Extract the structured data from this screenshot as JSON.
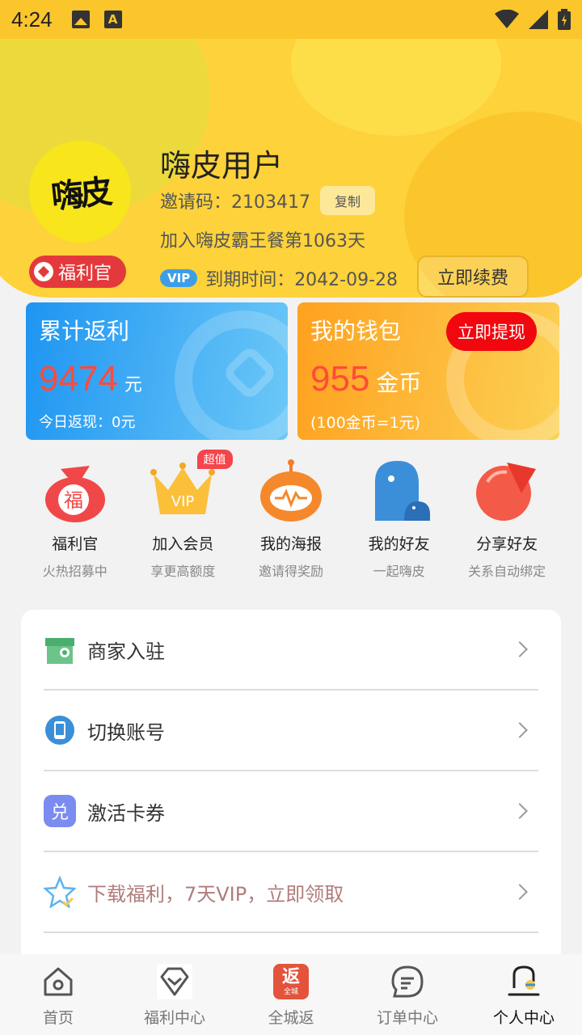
{
  "status_bar": {
    "time": "4:24",
    "icons": [
      "image-icon",
      "text-icon",
      "wifi-icon",
      "signal-icon",
      "battery-icon"
    ]
  },
  "profile": {
    "avatar_text": "嗨皮",
    "welfare_badge": "福利官",
    "username": "嗨皮用户",
    "invite_label": "邀请码：2103417",
    "copy_label": "复制",
    "join_text": "加入嗨皮霸王餐第1063天",
    "vip_label": "VIP",
    "expire_text": "到期时间：2042-09-28",
    "renew_label": "立即续费"
  },
  "rebate_card": {
    "title": "累计返利",
    "amount": "9474",
    "unit": "元",
    "today": "今日返现：0元"
  },
  "wallet_card": {
    "title": "我的钱包",
    "withdraw_label": "立即提现",
    "amount": "955",
    "unit": "金币",
    "rate": "(100金币=1元)"
  },
  "shortcuts": [
    {
      "label": "福利官",
      "sub": "火热招募中",
      "icon": "fortune-bag-icon"
    },
    {
      "label": "加入会员",
      "sub": "享更高额度",
      "icon": "vip-crown-icon",
      "tag": "超值"
    },
    {
      "label": "我的海报",
      "sub": "邀请得奖励",
      "icon": "poster-robot-icon"
    },
    {
      "label": "我的好友",
      "sub": "一起嗨皮",
      "icon": "friends-bird-icon"
    },
    {
      "label": "分享好友",
      "sub": "关系自动绑定",
      "icon": "share-peach-icon"
    }
  ],
  "menu": [
    {
      "label": "商家入驻",
      "icon": "store-icon"
    },
    {
      "label": "切换账号",
      "icon": "phone-icon"
    },
    {
      "label": "激活卡券",
      "icon": "redeem-icon",
      "icon_text": "兑"
    },
    {
      "label": "下载福利，7天VIP，立即领取",
      "icon": "star-icon"
    }
  ],
  "bottom_nav": [
    {
      "label": "首页",
      "icon": "home-icon"
    },
    {
      "label": "福利中心",
      "icon": "welfare-diamond-icon"
    },
    {
      "label": "全城返",
      "icon": "city-rebate-icon",
      "icon_text": "返",
      "icon_sub": "全城"
    },
    {
      "label": "订单中心",
      "icon": "order-icon"
    },
    {
      "label": "个人中心",
      "icon": "profile-icon",
      "active": true
    }
  ],
  "colors": {
    "brand_yellow": "#fbc52c",
    "rebate_blue": "#1e95f2",
    "wallet_orange": "#ffa11f",
    "amount_red": "#ff4b3a",
    "vip_blue": "#3d9ee8"
  }
}
